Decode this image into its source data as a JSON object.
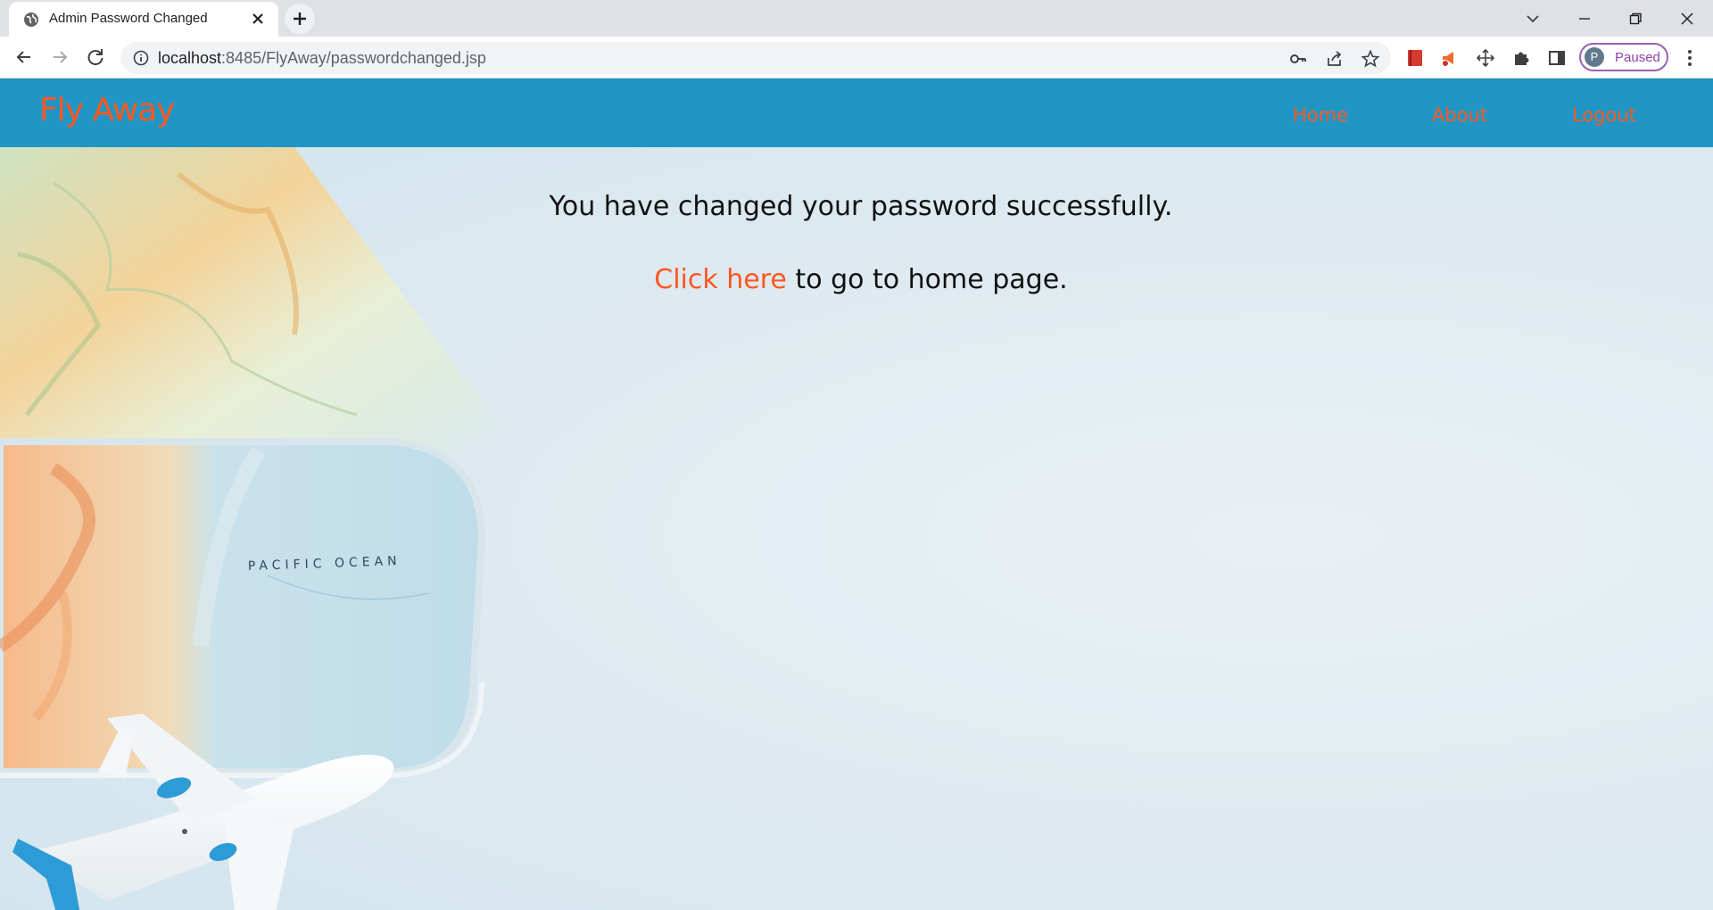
{
  "browser": {
    "tab_title": "Admin Password Changed",
    "url_host": "localhost",
    "url_rest": ":8485/FlyAway/passwordchanged.jsp",
    "profile_status": "Paused",
    "profile_initial": "P"
  },
  "navbar": {
    "brand": "Fly Away",
    "links": [
      "Home",
      "About",
      "Logout"
    ]
  },
  "content": {
    "success_message": "You have changed your password successfully.",
    "link_text": "Click here",
    "link_suffix": " to go to home page."
  },
  "background_image": {
    "map_label": "PACIFIC OCEAN"
  },
  "colors": {
    "navbar": "#2196c4",
    "accent": "#ff5722"
  }
}
